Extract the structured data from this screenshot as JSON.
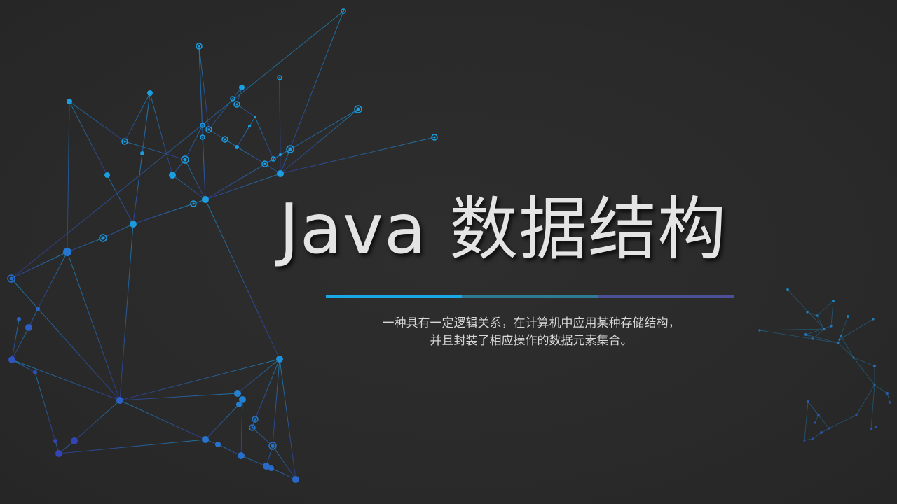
{
  "slide": {
    "title": "Java 数据结构",
    "subtitle_lines": [
      "一种具有一定逻辑关系，在计算机中应用某种存储结构，",
      "并且封装了相应操作的数据元素集合。"
    ]
  },
  "colors": {
    "background": "#2b2b2b",
    "title": "#e4e4e4",
    "subtitle": "#d8d8d8",
    "divider": [
      "#1aa7e6",
      "#2e7a92",
      "#4a4f96"
    ],
    "node_light": "#1a9ee0",
    "node_dark": "#3344b8"
  },
  "icons": {
    "left_decoration": "network-graph-icon",
    "right_decoration": "network-graph-icon"
  }
}
